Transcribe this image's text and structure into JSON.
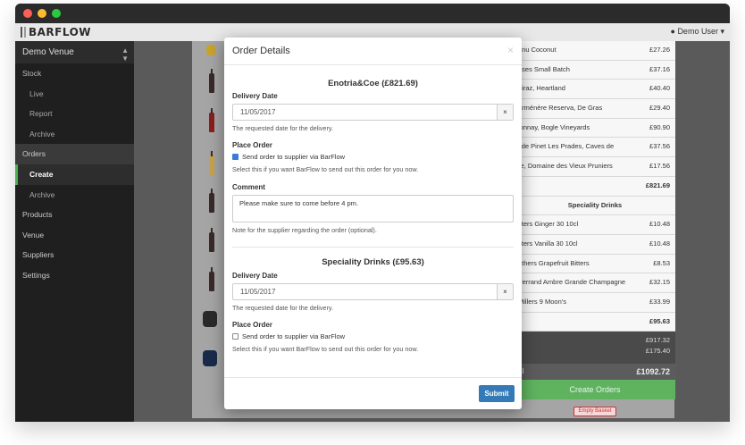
{
  "app": {
    "logo": "BARFLOW",
    "user": "Demo User"
  },
  "sidebar": {
    "venue": "Demo Venue",
    "items": [
      {
        "label": "Stock"
      },
      {
        "label": "Live"
      },
      {
        "label": "Report"
      },
      {
        "label": "Archive"
      },
      {
        "label": "Orders"
      },
      {
        "label": "Create"
      },
      {
        "label": "Archive"
      },
      {
        "label": "Products"
      },
      {
        "label": "Venue"
      },
      {
        "label": "Suppliers"
      },
      {
        "label": "Settings"
      }
    ]
  },
  "basket": {
    "rows1": [
      {
        "name": "anu Coconut",
        "price": "£27.26"
      },
      {
        "name": "oses Small Batch",
        "price": "£37.16"
      },
      {
        "name": "hiraz, Heartland",
        "price": "£40.40"
      },
      {
        "name": "arménère Reserva, De Gras",
        "price": "£29.40"
      },
      {
        "name": "lonnay, Bogle Vineyards",
        "price": "£90.90"
      },
      {
        "name": "l de Pinet Les Prades, Caves de",
        "price": "£37.56"
      },
      {
        "name": "re, Domaine des Vieux Pruniers",
        "price": "£17.56"
      }
    ],
    "subtotal1": "£821.69",
    "section2": "Speciality Drinks",
    "rows2": [
      {
        "name": "itters Ginger 30 10cl",
        "price": "£10.48"
      },
      {
        "name": "itters Vanilla 30 10cl",
        "price": "£10.48"
      },
      {
        "name": "others Grapefruit Bitters",
        "price": "£8.53"
      },
      {
        "name": "Ferrand Ambre Grande Champagne",
        "price": "£32.15"
      },
      {
        "name": "Millers 9 Moon's",
        "price": "£33.99"
      }
    ],
    "subtotal2": "£95.63",
    "summary1": "£917.32",
    "summary2": "£175.40",
    "total_label": "al",
    "total": "£1092.72",
    "create_label": "Create Orders",
    "empty_label": "Empty Basket"
  },
  "modal": {
    "title": "Order Details",
    "close": "×",
    "sections": [
      {
        "title": "Enotria&Coe (£821.69)",
        "delivery_label": "Delivery Date",
        "delivery_value": "11/05/2017",
        "delivery_help": "The requested date for the delivery.",
        "place_label": "Place Order",
        "checkbox_label": "Send order to supplier via BarFlow",
        "checked": true,
        "place_help": "Select this if you want BarFlow to send out this order for you now.",
        "comment_label": "Comment",
        "comment_value": "Please make sure to come before 4 pm.",
        "comment_help": "Note for the supplier regarding the order (optional)."
      },
      {
        "title": "Speciality Drinks (£95.63)",
        "delivery_label": "Delivery Date",
        "delivery_value": "11/05/2017",
        "delivery_help": "The requested date for the delivery.",
        "place_label": "Place Order",
        "checkbox_label": "Send order to supplier via BarFlow",
        "checked": false,
        "place_help": "Select this if you want BarFlow to send out this order for you now."
      }
    ],
    "clear": "×",
    "submit": "Submit"
  }
}
